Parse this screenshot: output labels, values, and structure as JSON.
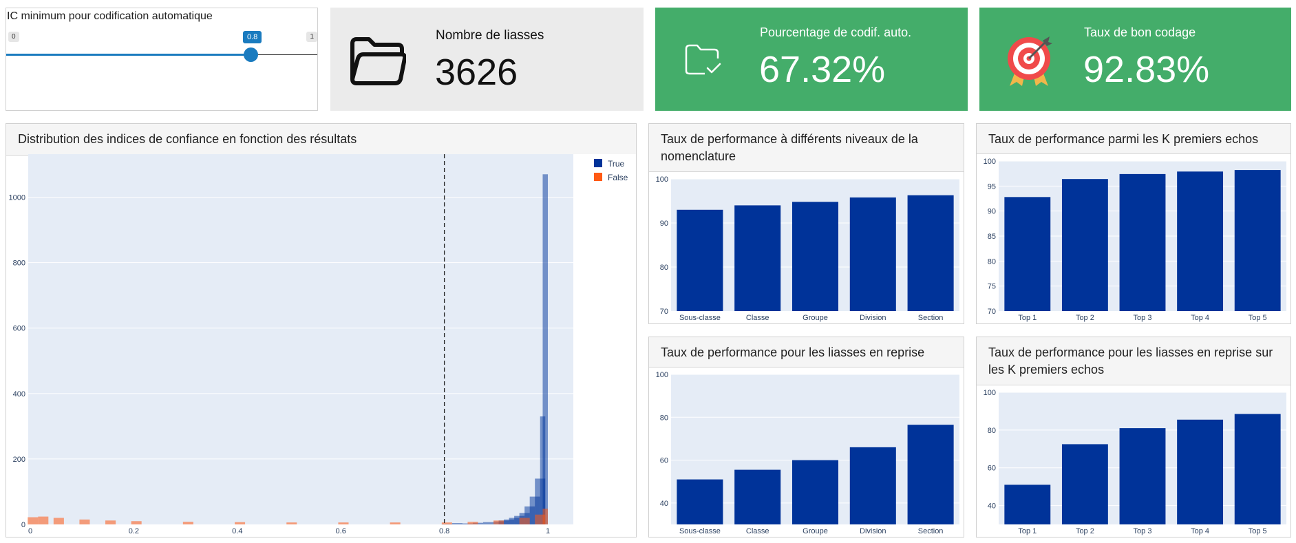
{
  "slider": {
    "label": "IC minimum pour codification automatique",
    "min_label": "0",
    "max_label": "1",
    "value_label": "0.8",
    "value": 0.8,
    "accent": "#1a7bbf"
  },
  "cards": [
    {
      "title": "Nombre de liasses",
      "value": "3626",
      "icon": "folder-icon",
      "bg": "#ebebeb",
      "fg": "#111111"
    },
    {
      "title": "Pourcentage de codif. auto.",
      "value": "67.32%",
      "icon": "folder-check-icon",
      "bg": "#44ad6a",
      "fg": "#ffffff"
    },
    {
      "title": "Taux de bon codage",
      "value": "92.83%",
      "icon": "target-icon",
      "bg": "#44ad6a",
      "fg": "#ffffff"
    }
  ],
  "panels": {
    "histogram": "Distribution des indices de confiance en fonction des résultats",
    "levels": "Taux de performance à différents niveaux de la nomenclature",
    "topk": "Taux de performance parmi les K premiers echos",
    "reprise_levels": "Taux de performance pour les liasses en reprise",
    "reprise_topk": "Taux de performance pour les liasses en reprise sur les K premiers echos"
  },
  "chart_data": [
    {
      "type": "bar",
      "subtype": "overlaid-histogram",
      "x_ticks": [
        "0",
        "0.2",
        "0.4",
        "0.6",
        "0.8",
        "1"
      ],
      "y_ticks": [
        "0",
        "200",
        "400",
        "600",
        "800",
        "1000"
      ],
      "xlim": [
        0,
        1
      ],
      "ylim": [
        0,
        1100
      ],
      "threshold_line": 0.8,
      "legend_position": "top-right",
      "series": [
        {
          "name": "True",
          "color": "#003399",
          "points": [
            [
              0.8,
              2
            ],
            [
              0.82,
              4
            ],
            [
              0.84,
              3
            ],
            [
              0.86,
              5
            ],
            [
              0.88,
              7
            ],
            [
              0.9,
              9
            ],
            [
              0.91,
              12
            ],
            [
              0.92,
              15
            ],
            [
              0.93,
              20
            ],
            [
              0.94,
              26
            ],
            [
              0.95,
              35
            ],
            [
              0.96,
              55
            ],
            [
              0.97,
              85
            ],
            [
              0.98,
              140
            ],
            [
              0.99,
              330
            ],
            [
              0.995,
              1070
            ]
          ]
        },
        {
          "name": "False",
          "color": "#ff5a14",
          "points": [
            [
              0.0,
              22
            ],
            [
              0.02,
              24
            ],
            [
              0.05,
              20
            ],
            [
              0.1,
              15
            ],
            [
              0.15,
              12
            ],
            [
              0.2,
              10
            ],
            [
              0.3,
              8
            ],
            [
              0.4,
              7
            ],
            [
              0.5,
              6
            ],
            [
              0.6,
              6
            ],
            [
              0.7,
              6
            ],
            [
              0.8,
              6
            ],
            [
              0.85,
              8
            ],
            [
              0.9,
              12
            ],
            [
              0.95,
              20
            ],
            [
              0.98,
              30
            ],
            [
              0.995,
              48
            ]
          ]
        }
      ]
    },
    {
      "type": "bar",
      "categories": [
        "Sous-classe",
        "Classe",
        "Groupe",
        "Division",
        "Section"
      ],
      "values": [
        93,
        94,
        94.8,
        95.8,
        96.3
      ],
      "ylim": [
        70,
        100
      ],
      "y_ticks": [
        "70",
        "80",
        "90",
        "100"
      ]
    },
    {
      "type": "bar",
      "categories": [
        "Top 1",
        "Top 2",
        "Top 3",
        "Top 4",
        "Top 5"
      ],
      "values": [
        92.8,
        96.4,
        97.4,
        97.9,
        98.2
      ],
      "ylim": [
        70,
        100
      ],
      "y_ticks": [
        "70",
        "75",
        "80",
        "85",
        "90",
        "95",
        "100"
      ]
    },
    {
      "type": "bar",
      "categories": [
        "Sous-classe",
        "Classe",
        "Groupe",
        "Division",
        "Section"
      ],
      "values": [
        51,
        55.5,
        60,
        66,
        76.5
      ],
      "ylim": [
        30,
        100
      ],
      "y_ticks": [
        "40",
        "60",
        "80",
        "100"
      ]
    },
    {
      "type": "bar",
      "categories": [
        "Top 1",
        "Top 2",
        "Top 3",
        "Top 4",
        "Top 5"
      ],
      "values": [
        51,
        72.5,
        81,
        85.5,
        88.5
      ],
      "ylim": [
        30,
        100
      ],
      "y_ticks": [
        "40",
        "60",
        "80",
        "100"
      ]
    }
  ]
}
